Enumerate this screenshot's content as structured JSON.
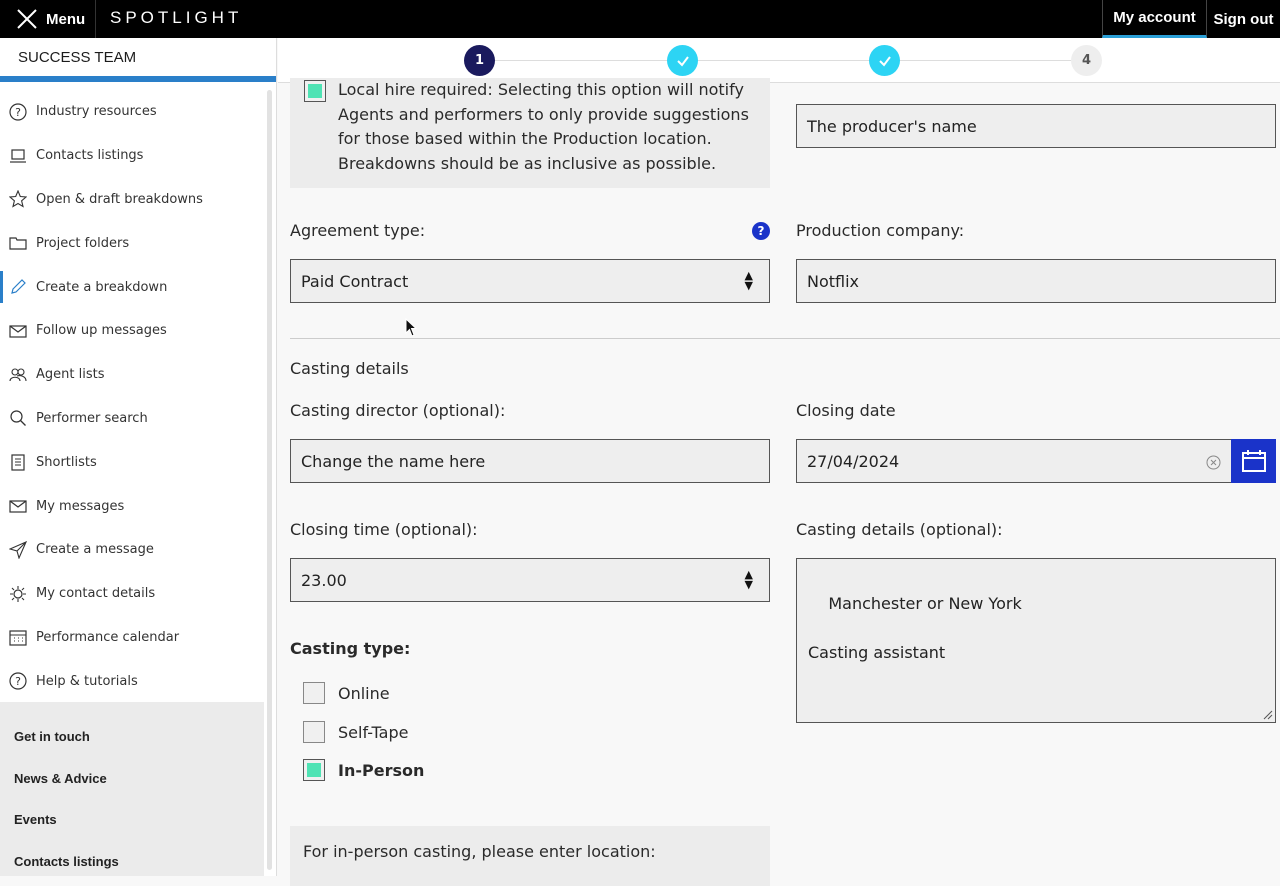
{
  "topbar": {
    "menu_label": "Menu",
    "logo": "SPOTLIGHT",
    "my_account": "My account",
    "sign_out": "Sign out"
  },
  "sidebar": {
    "team": "SUCCESS TEAM",
    "items": [
      {
        "label": "Industry resources",
        "icon": "help-circle-icon"
      },
      {
        "label": "Contacts listings",
        "icon": "laptop-icon"
      },
      {
        "label": "Open & draft breakdowns",
        "icon": "star-icon"
      },
      {
        "label": "Project folders",
        "icon": "folder-icon"
      },
      {
        "label": "Create a breakdown",
        "icon": "pencil-icon"
      },
      {
        "label": "Follow up messages",
        "icon": "envelope-icon"
      },
      {
        "label": "Agent lists",
        "icon": "people-icon"
      },
      {
        "label": "Performer search",
        "icon": "search-icon"
      },
      {
        "label": "Shortlists",
        "icon": "clipboard-icon"
      },
      {
        "label": "My messages",
        "icon": "envelope-icon"
      },
      {
        "label": "Create a message",
        "icon": "send-icon"
      },
      {
        "label": "My contact details",
        "icon": "gear-icon"
      },
      {
        "label": "Performance calendar",
        "icon": "calendar-icon"
      },
      {
        "label": "Help & tutorials",
        "icon": "help-circle-icon"
      }
    ],
    "footer": [
      "Get in touch",
      "News & Advice",
      "Events",
      "Contacts listings"
    ]
  },
  "stepper": {
    "step1": "1",
    "step4": "4"
  },
  "form": {
    "local_hire_text": "Local hire required: Selecting this option will notify Agents and performers to only provide suggestions for those based within the Production location. Breakdowns should be as inclusive as possible.",
    "producer_name_value": "The producer's name",
    "agreement_label": "Agreement type:",
    "agreement_value": "Paid Contract",
    "production_company_label": "Production company:",
    "production_company_value": "Notflix",
    "casting_details_heading": "Casting details",
    "casting_director_label": "Casting director (optional):",
    "casting_director_value": "Change the name here",
    "closing_date_label": "Closing date",
    "closing_date_value": "27/04/2024",
    "closing_time_label": "Closing time (optional):",
    "closing_time_value": "23.00",
    "casting_details_label": "Casting details (optional):",
    "casting_details_value": "Manchester or New York\n\nCasting assistant",
    "casting_type_label": "Casting type:",
    "casting_types": [
      {
        "label": "Online",
        "checked": false
      },
      {
        "label": "Self-Tape",
        "checked": false
      },
      {
        "label": "In-Person",
        "checked": true
      }
    ],
    "location_prompt": "For in-person casting, please enter location:"
  },
  "colors": {
    "accent_blue": "#1a33c9",
    "step_done": "#2dd4f4",
    "step_current": "#1a1a5e",
    "checkbox_fill": "#4fe3b4",
    "active_nav": "#2a7fc9"
  }
}
